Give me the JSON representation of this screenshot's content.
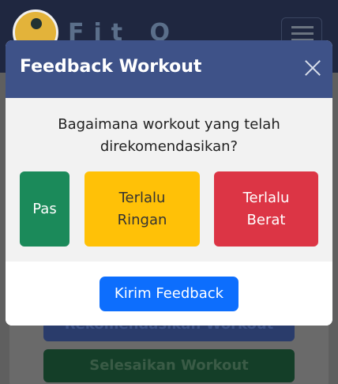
{
  "app": {
    "brand": "Fit Q"
  },
  "background_buttons": {
    "rekomendasi": "Rekomendasikan Workout",
    "selesai": "Selesaikan Workout"
  },
  "modal": {
    "title": "Feedback Workout",
    "question_line1": "Bagaimana workout yang telah",
    "question_line2": "direkomendasikan?",
    "options": [
      {
        "label": "Pas",
        "color": "#1b8a5a"
      },
      {
        "label_line1": "Terlalu",
        "label_line2": "Ringan",
        "color": "#ffc107"
      },
      {
        "label_line1": "Terlalu",
        "label_line2": "Berat",
        "color": "#dc3545"
      }
    ],
    "submit_label": "Kirim Feedback",
    "submit_color": "#0d6efd",
    "header_color": "#3e5288"
  }
}
